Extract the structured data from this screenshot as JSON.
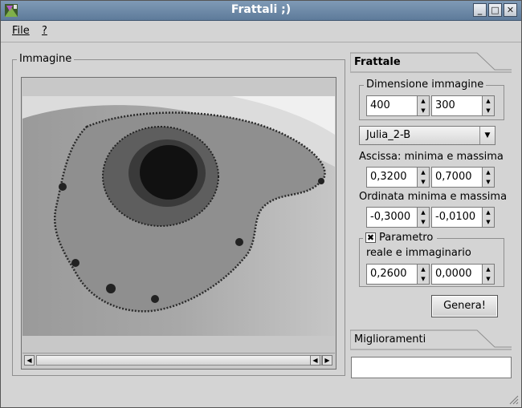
{
  "window": {
    "title": "Frattali ;)"
  },
  "menu": {
    "file": "File",
    "help": "?"
  },
  "image_panel": {
    "title": "Immagine"
  },
  "tabs": {
    "frattale": "Frattale",
    "miglioramenti": "Miglioramenti"
  },
  "dimension": {
    "title": "Dimensione immagine",
    "width": "400",
    "height": "300"
  },
  "fractal_type": {
    "selected": "Julia_2-B"
  },
  "abscissa": {
    "label": "Ascissa: minima e massima",
    "min": "0,3200",
    "max": "0,7000"
  },
  "ordinate": {
    "label": "Ordinata minima e massima",
    "min": "-0,3000",
    "max": "-0,0100"
  },
  "parameter": {
    "title": "Parametro",
    "checked": true,
    "check_mark": "✖",
    "sublabel": "reale e immaginario",
    "real": "0,2600",
    "imag": "0,0000"
  },
  "generate_button": "Genera!",
  "colors": {
    "titlebar": "#6b86a3",
    "window_bg": "#d4d4d4"
  }
}
